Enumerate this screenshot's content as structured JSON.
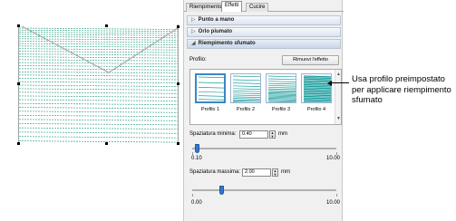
{
  "tabs": [
    {
      "label": "Riempimento"
    },
    {
      "label": "Effetti"
    },
    {
      "label": "Cucire"
    }
  ],
  "sections": {
    "punto_a_mano": {
      "label": "Punto a mano",
      "arrow": "▷"
    },
    "orlo_piumato": {
      "label": "Orlo piumato",
      "arrow": "▷"
    },
    "riempimento_sfumato": {
      "label": "Riempimento sfumato",
      "arrow": "◢"
    }
  },
  "profile_section": {
    "label": "Profilo:",
    "remove_button": "Rimuovi l'effetto",
    "profiles": [
      {
        "name": "Profilo 1"
      },
      {
        "name": "Profilo 2"
      },
      {
        "name": "Profilo 3"
      },
      {
        "name": "Profilo 4"
      }
    ]
  },
  "min_spacing": {
    "label": "Spaziatura minima:",
    "value": "0.40",
    "unit": "mm",
    "range_min": "0.10",
    "range_max": "10.00",
    "level_fraction": 0.03
  },
  "max_spacing": {
    "label": "Spaziatura massima:",
    "value": "2.00",
    "unit": "mm",
    "range_min": "0.00",
    "range_max": "10.00",
    "level_fraction": 0.2
  },
  "callout": {
    "text": "Usa profilo preimpostato per applicare riempimento sfumato"
  },
  "colors": {
    "stitch": "#3aa58c",
    "thumb_stitch": "#1e9e9e",
    "selected_border": "#3d85c6",
    "slider_thumb": "#2f7ad0"
  }
}
